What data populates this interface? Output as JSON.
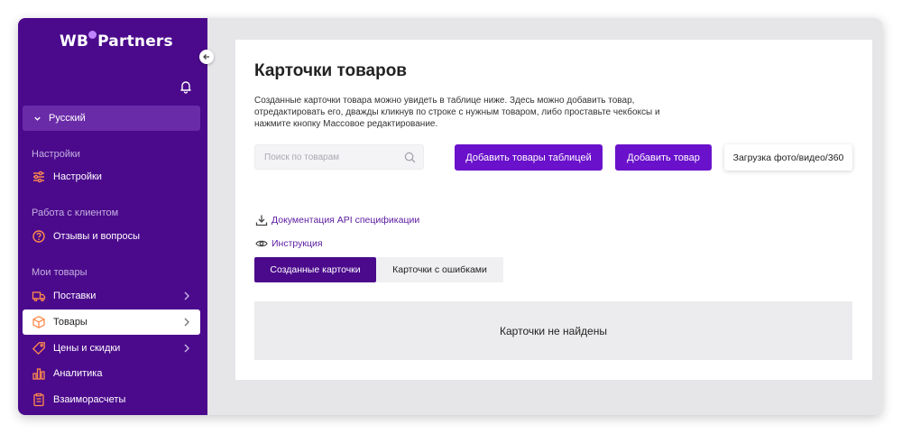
{
  "brand": {
    "logo_left": "WB",
    "logo_right": "Partners",
    "accent": "#4b0a8c",
    "primary_button": "#6a11cb"
  },
  "sidebar": {
    "language": "Русский",
    "sections": [
      {
        "title": "Настройки",
        "items": [
          {
            "label": "Настройки",
            "icon": "sliders-icon"
          }
        ]
      },
      {
        "title": "Работа с клиентом",
        "items": [
          {
            "label": "Отзывы и вопросы",
            "icon": "question-circle-icon"
          }
        ]
      },
      {
        "title": "Мои товары",
        "items": [
          {
            "label": "Поставки",
            "icon": "truck-icon",
            "has_arrow": true
          },
          {
            "label": "Товары",
            "icon": "box-icon",
            "has_arrow": true,
            "active": true
          },
          {
            "label": "Цены и скидки",
            "icon": "tag-icon",
            "has_arrow": true
          },
          {
            "label": "Аналитика",
            "icon": "bar-chart-icon"
          },
          {
            "label": "Взаиморасчеты",
            "icon": "clipboard-icon"
          }
        ]
      }
    ]
  },
  "main": {
    "title": "Карточки товаров",
    "description": "Созданные карточки товара можно увидеть в таблице ниже. Здесь можно добавить товар, отредактировать его, дважды кликнув по строке с нужным товаром, либо проставьте чекбоксы и нажмите кнопку Массовое редактирование.",
    "search_placeholder": "Поиск по товарам",
    "buttons": {
      "add_table": "Добавить товары таблицей",
      "add_item": "Добавить товар",
      "upload_media": "Загрузка фото/видео/360"
    },
    "links": {
      "api_docs": "Документация API спецификации",
      "instruction": "Инструкция"
    },
    "tabs": [
      {
        "label": "Созданные карточки",
        "active": true
      },
      {
        "label": "Карточки с ошибками",
        "active": false
      }
    ],
    "empty_message": "Карточки не найдены"
  }
}
